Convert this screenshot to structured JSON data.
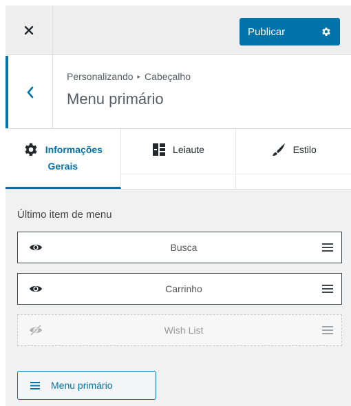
{
  "header": {
    "publish_label": "Publicar"
  },
  "section": {
    "breadcrumb_parent": "Personalizando",
    "breadcrumb_child": "Cabeçalho",
    "title": "Menu primário"
  },
  "tabs": [
    {
      "line1": "Informações",
      "line2": "Gerais",
      "icon": "gear-icon",
      "active": true
    },
    {
      "label": "Leiaute",
      "icon": "layout-icon",
      "active": false
    },
    {
      "label": "Estilo",
      "icon": "brush-icon",
      "active": false
    }
  ],
  "content": {
    "label": "Último item de menu",
    "items": [
      {
        "label": "Busca",
        "visible": true
      },
      {
        "label": "Carrinho",
        "visible": true
      },
      {
        "label": "Wish List",
        "visible": false
      }
    ],
    "menu_button_label": "Menu primário"
  },
  "colors": {
    "accent": "#0073aa",
    "panel_bg": "#f1f1f1",
    "header_bg": "#eeeeee"
  }
}
